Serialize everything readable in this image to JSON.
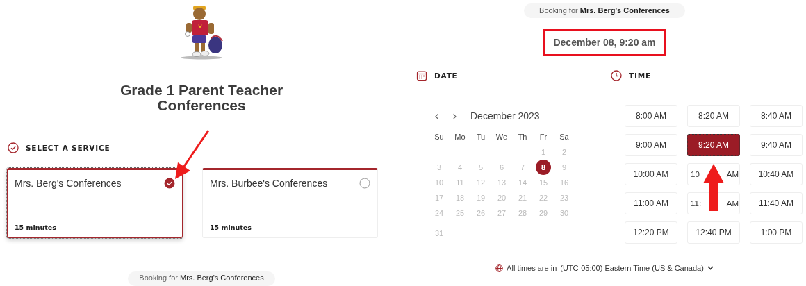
{
  "title": "Grade 1 Parent Teacher Conferences",
  "service_section": {
    "heading": "SELECT A SERVICE"
  },
  "services": [
    {
      "name": "Mrs. Berg's Conferences",
      "duration": "15 minutes",
      "selected": true
    },
    {
      "name": "Mrs. Burbee's Conferences",
      "duration": "15 minutes",
      "selected": false
    }
  ],
  "booking_bottom": {
    "label": "Booking for",
    "service": "Mrs. Berg's Conferences"
  },
  "booking_top": "Booking for **Mrs. Berg's Conferences**",
  "selected_datetime": "December 08, 9:20 am",
  "date_section": {
    "heading": "DATE",
    "prev": "‹",
    "next": "›",
    "month": "December 2023",
    "weekdays": [
      "Su",
      "Mo",
      "Tu",
      "We",
      "Th",
      "Fr",
      "Sa"
    ],
    "days": [
      {
        "day": "1",
        "selected": false
      },
      {
        "day": "2",
        "selected": false
      },
      {
        "day": "3",
        "selected": false
      },
      {
        "day": "4",
        "selected": false
      },
      {
        "day": "5",
        "selected": false
      },
      {
        "day": "6",
        "selected": false
      },
      {
        "day": "7",
        "selected": false
      },
      {
        "day": "8",
        "selected": true
      },
      {
        "day": "9",
        "selected": false
      },
      {
        "day": "10",
        "selected": false
      },
      {
        "day": "11",
        "selected": false
      },
      {
        "day": "12",
        "selected": false
      },
      {
        "day": "13",
        "selected": false
      },
      {
        "day": "14",
        "selected": false
      },
      {
        "day": "15",
        "selected": false
      },
      {
        "day": "16",
        "selected": false
      },
      {
        "day": "17",
        "selected": false
      },
      {
        "day": "18",
        "selected": false
      },
      {
        "day": "19",
        "selected": false
      },
      {
        "day": "20",
        "selected": false
      },
      {
        "day": "21",
        "selected": false
      },
      {
        "day": "22",
        "selected": false
      },
      {
        "day": "23",
        "selected": false
      },
      {
        "day": "24",
        "selected": false
      },
      {
        "day": "25",
        "selected": false
      },
      {
        "day": "26",
        "selected": false
      },
      {
        "day": "27",
        "selected": false
      },
      {
        "day": "28",
        "selected": false
      },
      {
        "day": "29",
        "selected": false
      },
      {
        "day": "30",
        "selected": false
      },
      {
        "day": "31",
        "selected": false
      }
    ]
  },
  "time_section": {
    "heading": "TIME",
    "slots": [
      {
        "time": "8:00 AM",
        "selected": false
      },
      {
        "time": "8:20 AM",
        "selected": false
      },
      {
        "time": "8:40 AM",
        "selected": false
      },
      {
        "time": "9:00 AM",
        "selected": false
      },
      {
        "time": "9:20 AM",
        "selected": true
      },
      {
        "time": "9:40 AM",
        "selected": false
      },
      {
        "time": "10:00 AM",
        "selected": false
      },
      {
        "kind": "covered",
        "start": "10",
        "end": "AM",
        "selected": false
      },
      {
        "time": "10:40 AM",
        "selected": false
      },
      {
        "time": "11:00 AM",
        "selected": false
      },
      {
        "kind": "covered",
        "start": "11:",
        "end": "AM",
        "selected": false
      },
      {
        "time": "11:40 AM",
        "selected": false
      },
      {
        "time": "12:20 PM",
        "selected": false
      },
      {
        "time": "12:40 PM",
        "selected": false
      },
      {
        "time": "1:00 PM",
        "selected": false
      }
    ]
  },
  "timezone": {
    "label": "All times are in",
    "zone": "(UTC-05:00) Eastern Time (US & Canada)"
  }
}
